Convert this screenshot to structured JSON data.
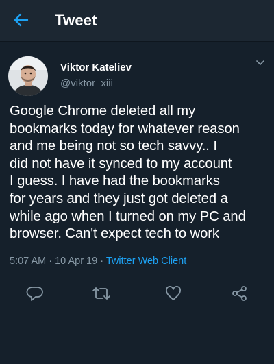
{
  "header": {
    "back_icon": "arrow-left-icon",
    "title": "Tweet"
  },
  "tweet": {
    "author": {
      "name": "Viktor Kateliev",
      "handle": "@viktor_xiii"
    },
    "text": "Google Chrome deleted all my\nbookmarks today for whatever reason\nand me being not so tech savvy.. I\ndid not have it synced to my account\nI guess. I have had the bookmarks\nfor years and they just got deleted a\nwhile ago when I turned on my PC and\nbrowser. Can't expect tech to work",
    "time": "5:07 AM",
    "date": "10 Apr 19",
    "separator": "·",
    "source": "Twitter Web Client"
  },
  "actions": [
    {
      "icon": "reply-icon"
    },
    {
      "icon": "retweet-icon"
    },
    {
      "icon": "like-icon"
    },
    {
      "icon": "share-icon"
    }
  ],
  "colors": {
    "background": "#15202b",
    "header_background": "#1c2732",
    "accent": "#1da1f2",
    "secondary_text": "#8899a6"
  }
}
